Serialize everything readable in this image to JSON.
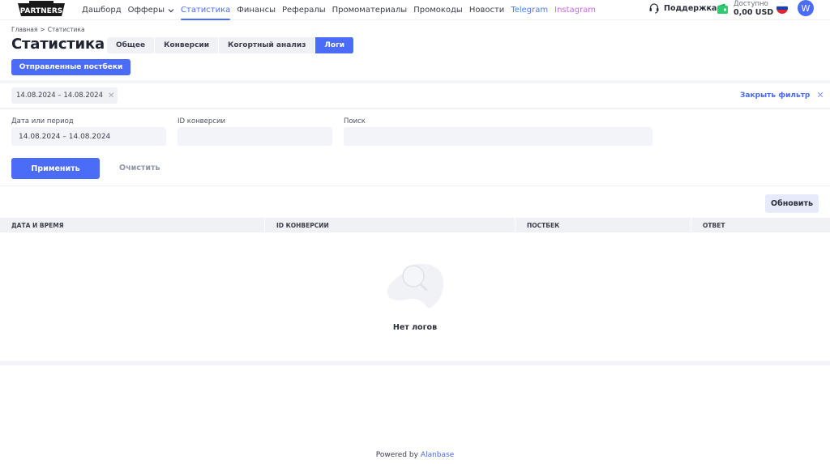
{
  "header": {
    "logo_text": "PARTNERS",
    "nav": [
      {
        "label": "Дашборд",
        "active": false
      },
      {
        "label": "Офферы",
        "active": false,
        "has_dropdown": true
      },
      {
        "label": "Статистика",
        "active": true
      },
      {
        "label": "Финансы",
        "active": false
      },
      {
        "label": "Рефералы",
        "active": false
      },
      {
        "label": "Промоматериалы",
        "active": false
      },
      {
        "label": "Промокоды",
        "active": false
      },
      {
        "label": "Новости",
        "active": false
      },
      {
        "label": "Telegram",
        "active": false
      },
      {
        "label": "Instagram",
        "active": false
      }
    ],
    "support_label": "Поддержка",
    "balance_label": "Доступно",
    "balance_value": "0,00 USD",
    "language": "ru",
    "avatar_initial": "W"
  },
  "breadcrumb": {
    "home": "Главная",
    "separator": ">",
    "current": "Статистика"
  },
  "page": {
    "title": "Статистика",
    "tabs": [
      {
        "label": "Общее",
        "active": false
      },
      {
        "label": "Конверсии",
        "active": false
      },
      {
        "label": "Когортный анализ",
        "active": false
      },
      {
        "label": "Логи",
        "active": true
      }
    ],
    "subtab_label": "Отправленные постбеки"
  },
  "filter": {
    "active_chip": "14.08.2024 – 14.08.2024",
    "close_filter_label": "Закрыть фильтр",
    "fields": {
      "date_label": "Дата или период",
      "date_value": "14.08.2024 – 14.08.2024",
      "conversion_id_label": "ID конверсии",
      "conversion_id_value": "",
      "search_label": "Поиск",
      "search_value": ""
    },
    "apply_label": "Применить",
    "clear_label": "Очистить"
  },
  "table": {
    "refresh_label": "Обновить",
    "columns": [
      "ДАТА И ВРЕМЯ",
      "ID КОНВЕРСИИ",
      "ПОСТБЕК",
      "ОТВЕТ"
    ],
    "rows": [],
    "empty_text": "Нет логов"
  },
  "footer": {
    "powered_by": "Powered by",
    "brand": "Alanbase"
  },
  "colors": {
    "accent": "#4a6cf7",
    "telegram": "#4a7cf7",
    "instagram": "#c86ae8",
    "wallet": "#2ecc71"
  }
}
